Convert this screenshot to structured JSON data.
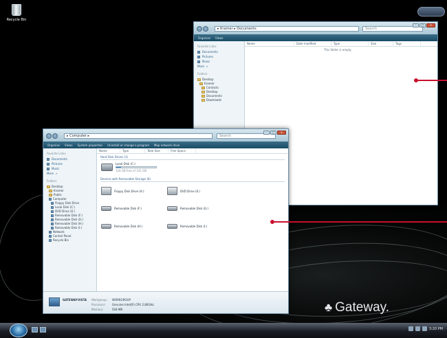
{
  "desktop": {
    "recycle_bin_label": "Recycle Bin",
    "brand": "Gateway."
  },
  "documents_window": {
    "breadcrumb": [
      "Kramer",
      "Documents"
    ],
    "search_placeholder": "Search",
    "toolbar": [
      "Organize",
      "Views"
    ],
    "favorite_links_header": "Favorite Links",
    "favorite_links": [
      "Documents",
      "Pictures",
      "Music"
    ],
    "more_label": "More",
    "folders_header": "Folders",
    "folder_tree": [
      "Desktop",
      "Kramer",
      "Contacts",
      "Desktop",
      "Documents",
      "Downloads"
    ],
    "columns": [
      "Name",
      "Date modified",
      "Type",
      "Size",
      "Tags"
    ],
    "empty_message": "This folder is empty."
  },
  "computer_window": {
    "breadcrumb": [
      "Computer"
    ],
    "search_placeholder": "Search",
    "toolbar": [
      "Organize",
      "Views",
      "System properties",
      "Uninstall or change a program",
      "Map network drive"
    ],
    "favorite_links_header": "Favorite Links",
    "favorite_links": [
      "Documents",
      "Pictures",
      "Music"
    ],
    "more_label": "More",
    "folders_header": "Folders",
    "folder_tree": [
      "Desktop",
      "Kramer",
      "Public",
      "Computer",
      "Floppy Disk Drive",
      "Local Disk (C:)",
      "DVD Drive (E:)",
      "Removable Disk (F:)",
      "Removable Disk (G:)",
      "Removable Disk (H:)",
      "Removable Disk (I:)",
      "Network",
      "Control Panel",
      "Recycle Bin"
    ],
    "columns": [
      "Name",
      "Type",
      "Total Size",
      "Free Space"
    ],
    "hard_disk_section": "Hard Disk Drives (1)",
    "local_disk_name": "Local Disk (C:)",
    "local_disk_space": "124 GB free of 141 GB",
    "removable_section": "Devices with Removable Storage (6)",
    "devices": [
      {
        "name": "Floppy Disk Drive (A:)"
      },
      {
        "name": "DVD Drive (E:)"
      },
      {
        "name": "Removable Disk (F:)"
      },
      {
        "name": "Removable Disk (G:)"
      },
      {
        "name": "Removable Disk (H:)"
      },
      {
        "name": "Removable Disk (I:)"
      }
    ],
    "details": {
      "computer_name": "GATEWAY-VISTA",
      "workgroup_label": "Workgroup:",
      "workgroup": "WORKGROUP",
      "processor_label": "Processor:",
      "processor": "Genuine Intel(R) CPU 2.80GHz",
      "memory_label": "Memory:",
      "memory": "504 MB"
    }
  },
  "taskbar": {
    "clock": "3:20 PM"
  }
}
